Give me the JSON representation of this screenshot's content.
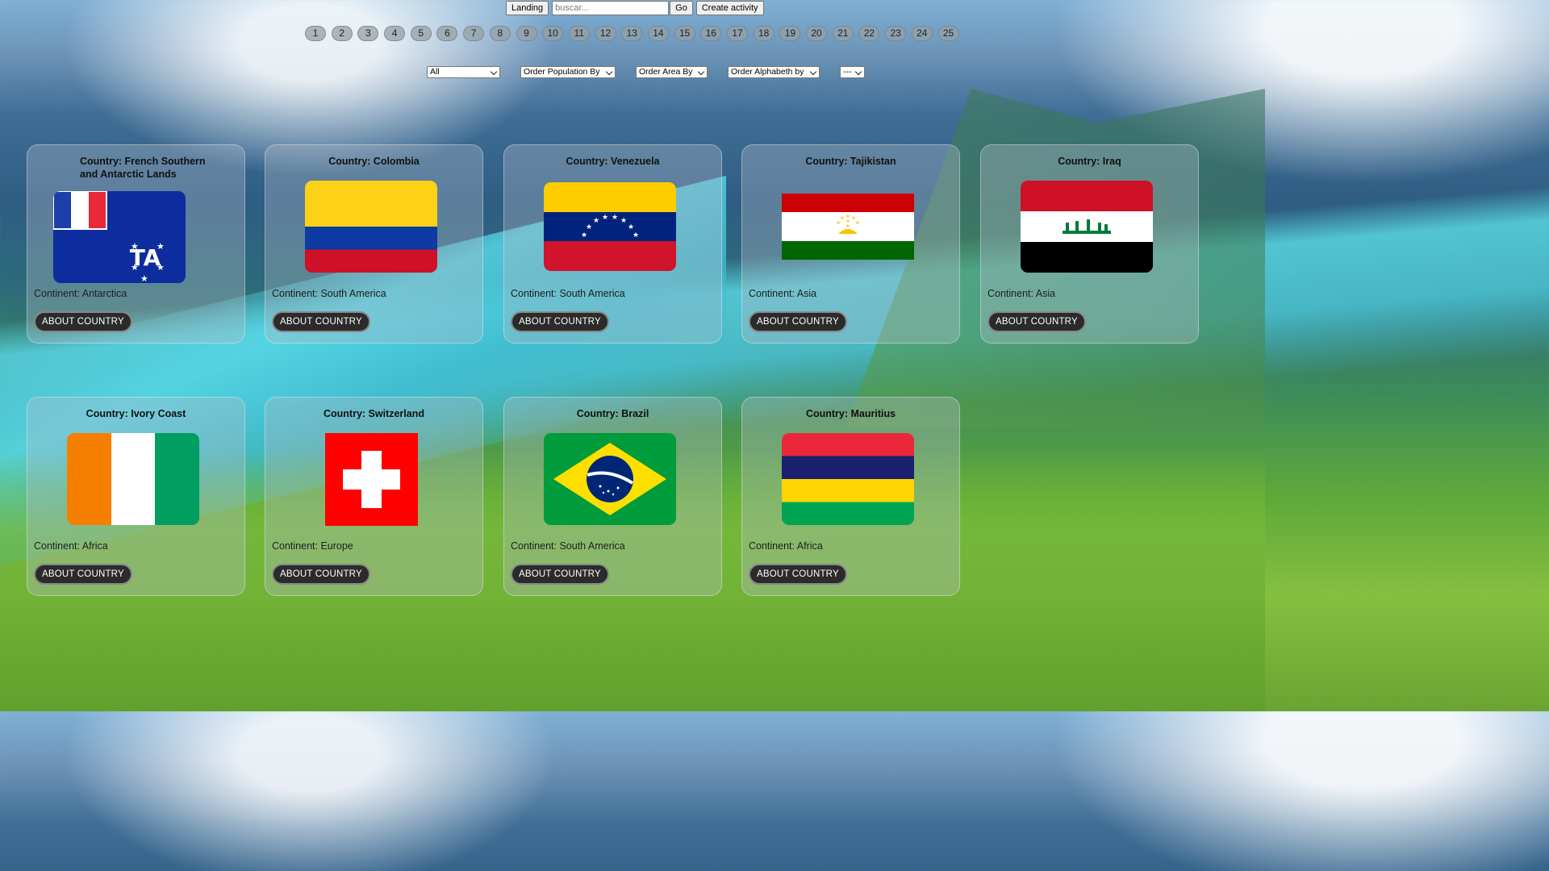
{
  "topbar": {
    "landing_label": "Landing",
    "search_placeholder": "buscar...",
    "go_label": "Go",
    "create_label": "Create activity"
  },
  "pagination": [
    "1",
    "2",
    "3",
    "4",
    "5",
    "6",
    "7",
    "8",
    "9",
    "10",
    "11",
    "12",
    "13",
    "14",
    "15",
    "16",
    "17",
    "18",
    "19",
    "20",
    "21",
    "22",
    "23",
    "24",
    "25"
  ],
  "filters": {
    "continent_selected": "All",
    "population_selected": "Order Population By",
    "area_selected": "Order Area By",
    "alphabet_selected": "Order Alphabeth by",
    "activity_selected": "---"
  },
  "cards": [
    {
      "country": "Country: French Southern and Antarctic Lands",
      "continent": "Continent: Antarctica",
      "button": "ABOUT COUNTRY",
      "flag_icon": "flag-french-southern-lands-icon"
    },
    {
      "country": "Country: Colombia",
      "continent": "Continent: South America",
      "button": "ABOUT COUNTRY",
      "flag_icon": "flag-colombia-icon"
    },
    {
      "country": "Country: Venezuela",
      "continent": "Continent: South America",
      "button": "ABOUT COUNTRY",
      "flag_icon": "flag-venezuela-icon"
    },
    {
      "country": "Country: Tajikistan",
      "continent": "Continent: Asia",
      "button": "ABOUT COUNTRY",
      "flag_icon": "flag-tajikistan-icon"
    },
    {
      "country": "Country: Iraq",
      "continent": "Continent: Asia",
      "button": "ABOUT COUNTRY",
      "flag_icon": "flag-iraq-icon"
    },
    {
      "country": "Country: Ivory Coast",
      "continent": "Continent: Africa",
      "button": "ABOUT COUNTRY",
      "flag_icon": "flag-ivory-coast-icon"
    },
    {
      "country": "Country: Switzerland",
      "continent": "Continent: Europe",
      "button": "ABOUT COUNTRY",
      "flag_icon": "flag-switzerland-icon"
    },
    {
      "country": "Country: Brazil",
      "continent": "Continent: South America",
      "button": "ABOUT COUNTRY",
      "flag_icon": "flag-brazil-icon"
    },
    {
      "country": "Country: Mauritius",
      "continent": "Continent: Africa",
      "button": "ABOUT COUNTRY",
      "flag_icon": "flag-mauritius-icon"
    }
  ],
  "colors": {
    "button_bg": "#2b2b2b",
    "card_bg": "rgba(180,190,200,0.35)"
  }
}
